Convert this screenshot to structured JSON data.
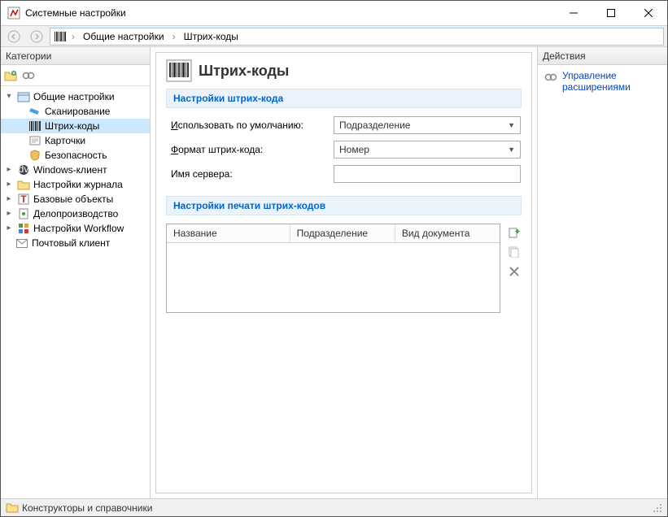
{
  "window": {
    "title": "Системные настройки"
  },
  "breadcrumb": {
    "item1": "Общие настройки",
    "item2": "Штрих-коды"
  },
  "sidebar": {
    "header": "Категории",
    "items": [
      {
        "label": "Общие настройки"
      },
      {
        "label": "Сканирование"
      },
      {
        "label": "Штрих-коды"
      },
      {
        "label": "Карточки"
      },
      {
        "label": "Безопасность"
      },
      {
        "label": "Windows-клиент"
      },
      {
        "label": "Настройки журнала"
      },
      {
        "label": "Базовые объекты"
      },
      {
        "label": "Делопроизводство"
      },
      {
        "label": "Настройки Workflow"
      },
      {
        "label": "Почтовый клиент"
      }
    ]
  },
  "page": {
    "title": "Штрих-коды",
    "section1": "Настройки штрих-кода",
    "section2": "Настройки печати штрих-кодов",
    "field1_label_pre": "И",
    "field1_label_rest": "спользовать по умолчанию:",
    "field1_value": "Подразделение",
    "field2_label_pre": "Ф",
    "field2_label_rest": "ормат штрих-кода:",
    "field2_value": "Номер",
    "field3_label": "Имя сервера:",
    "field3_value": "",
    "table_cols": {
      "c1": "Название",
      "c2": "Подразделение",
      "c3": "Вид документа"
    }
  },
  "actions": {
    "header": "Действия",
    "link1": "Управление расширениями"
  },
  "status": {
    "text": "Конструкторы и справочники"
  }
}
